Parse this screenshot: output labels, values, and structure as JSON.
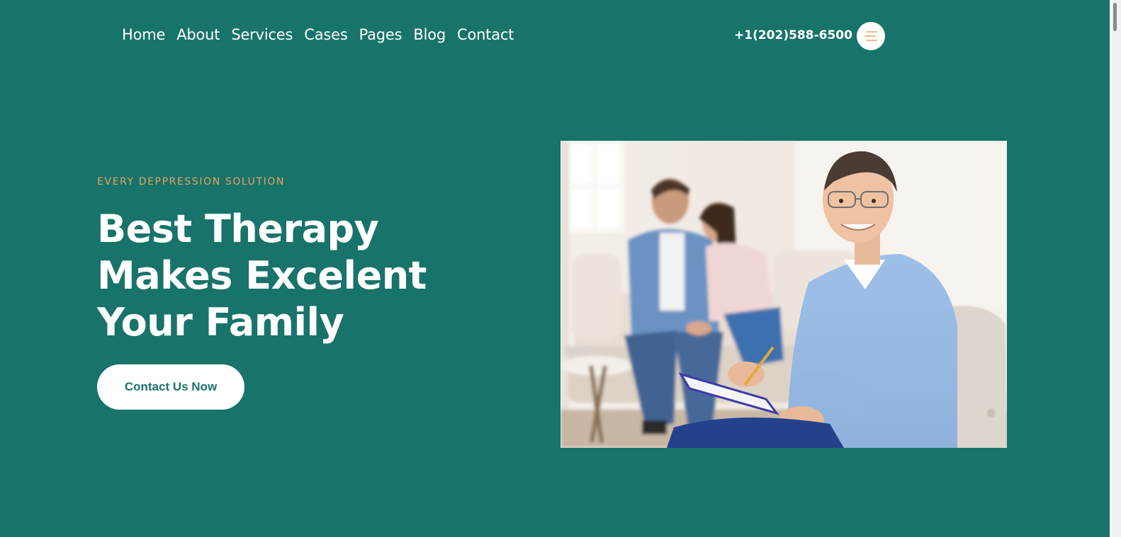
{
  "nav": {
    "items": [
      {
        "label": "Home"
      },
      {
        "label": "About"
      },
      {
        "label": "Services"
      },
      {
        "label": "Cases"
      },
      {
        "label": "Pages"
      },
      {
        "label": "Blog"
      },
      {
        "label": "Contact"
      }
    ],
    "phone": "+1(202)588-6500",
    "menu_icon": "hamburger-menu-icon"
  },
  "hero": {
    "eyebrow": "EVERY DEPPRESSION SOLUTION",
    "headline": [
      "Best  Therapy",
      "Makes  Excelent",
      "Your  Family"
    ],
    "cta_label": "Contact Us Now",
    "photo": "therapist-with-couple-photo"
  },
  "colors": {
    "background": "#18736a",
    "accent": "#e6a262",
    "text": "#ffffff"
  }
}
